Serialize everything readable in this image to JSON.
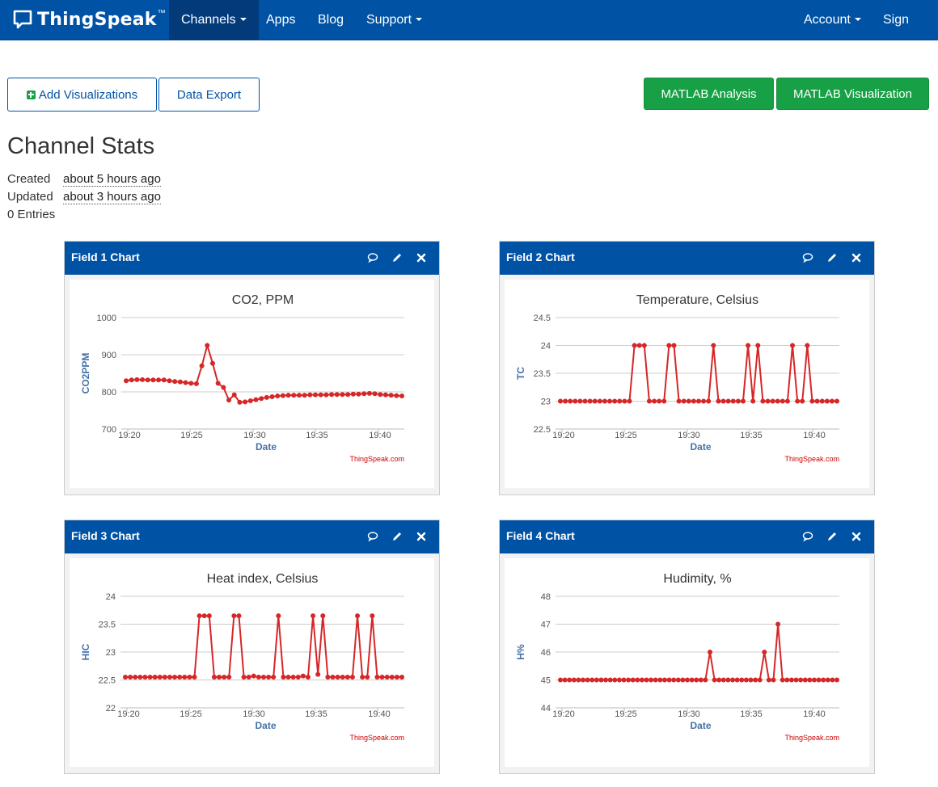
{
  "nav": {
    "brand": "ThingSpeak",
    "brand_tm": "™",
    "items": [
      "Channels",
      "Apps",
      "Blog",
      "Support"
    ],
    "account": "Account",
    "sign_out": "Sign Out"
  },
  "toolbar": {
    "add_visualizations": "Add Visualizations",
    "data_export": "Data Export",
    "matlab_analysis": "MATLAB Analysis",
    "matlab_visualization": "MATLAB Visualization"
  },
  "stats": {
    "title": "Channel Stats",
    "created_label": "Created",
    "created_value": "about 5 hours ago",
    "updated_label": "Updated",
    "updated_value": "about 3 hours ago",
    "entries": "0 Entries"
  },
  "colors": {
    "nav_bg": "#0052a5",
    "nav_active": "#023a7a",
    "green": "#17a045",
    "series": "#d62728",
    "axis_label": "#4572a7"
  },
  "chart_data": [
    {
      "panel_title": "Field 1 Chart",
      "type": "line",
      "title": "CO2, PPM",
      "xlabel": "Date",
      "ylabel": "CO2PPM",
      "credit": "ThingSpeak.com",
      "ylim": [
        700,
        1000
      ],
      "yticks": [
        700,
        800,
        900,
        1000
      ],
      "ytick_labels": [
        "700",
        "800",
        "900",
        "1000"
      ],
      "xlim": [
        19.3,
        19.7
      ],
      "xticks": [
        "19:20",
        "19:25",
        "19:30",
        "19:35",
        "19:40"
      ],
      "series": [
        {
          "values": [
            830,
            832,
            833,
            833,
            832,
            832,
            832,
            832,
            830,
            828,
            827,
            825,
            823,
            822,
            870,
            925,
            877,
            823,
            812,
            778,
            792,
            772,
            773,
            776,
            779,
            782,
            785,
            787,
            789,
            790,
            791,
            791,
            791,
            791,
            792,
            792,
            792,
            792,
            793,
            793,
            793,
            793,
            794,
            794,
            795,
            796,
            795,
            793,
            792,
            791,
            790,
            789
          ]
        }
      ]
    },
    {
      "panel_title": "Field 2 Chart",
      "type": "line",
      "title": "Temperature, Celsius",
      "xlabel": "Date",
      "ylabel": "TC",
      "credit": "ThingSpeak.com",
      "ylim": [
        22.5,
        24.5
      ],
      "yticks": [
        22.5,
        23,
        23.5,
        24,
        24.5
      ],
      "ytick_labels": [
        "22.5",
        "23",
        "23.5",
        "24",
        "24.5"
      ],
      "xticks": [
        "19:20",
        "19:25",
        "19:30",
        "19:35",
        "19:40"
      ],
      "series": [
        {
          "values": [
            23,
            23,
            23,
            23,
            23,
            23,
            23,
            23,
            23,
            23,
            23,
            23,
            23,
            23,
            23,
            24,
            24,
            24,
            23,
            23,
            23,
            23,
            24,
            24,
            23,
            23,
            23,
            23,
            23,
            23,
            23,
            24,
            23,
            23,
            23,
            23,
            23,
            23,
            24,
            23,
            24,
            23,
            23,
            23,
            23,
            23,
            23,
            24,
            23,
            23,
            24,
            23,
            23,
            23,
            23,
            23,
            23
          ]
        }
      ]
    },
    {
      "panel_title": "Field 3 Chart",
      "type": "line",
      "title": "Heat index, Celsius",
      "xlabel": "Date",
      "ylabel": "HIC",
      "credit": "ThingSpeak.com",
      "ylim": [
        22,
        24
      ],
      "yticks": [
        22,
        22.5,
        23,
        23.5,
        24
      ],
      "ytick_labels": [
        "22",
        "22.5",
        "23",
        "23.5",
        "24"
      ],
      "xticks": [
        "19:20",
        "19:25",
        "19:30",
        "19:35",
        "19:40"
      ],
      "series": [
        {
          "values": [
            22.55,
            22.55,
            22.55,
            22.55,
            22.55,
            22.55,
            22.55,
            22.55,
            22.55,
            22.55,
            22.55,
            22.55,
            22.55,
            22.55,
            22.55,
            23.65,
            23.65,
            23.65,
            22.55,
            22.55,
            22.55,
            22.55,
            23.65,
            23.65,
            22.55,
            22.55,
            22.57,
            22.55,
            22.55,
            22.55,
            22.55,
            23.65,
            22.55,
            22.55,
            22.55,
            22.55,
            22.57,
            22.55,
            23.65,
            22.6,
            23.65,
            22.55,
            22.55,
            22.55,
            22.55,
            22.55,
            22.55,
            23.65,
            22.55,
            22.55,
            23.65,
            22.55,
            22.55,
            22.55,
            22.55,
            22.55,
            22.55
          ]
        }
      ]
    },
    {
      "panel_title": "Field 4 Chart",
      "type": "line",
      "title": "Hudimity, %",
      "xlabel": "Date",
      "ylabel": "H%",
      "credit": "ThingSpeak.com",
      "ylim": [
        44,
        48
      ],
      "yticks": [
        44,
        45,
        46,
        47,
        48
      ],
      "ytick_labels": [
        "44",
        "45",
        "46",
        "47",
        "48"
      ],
      "xticks": [
        "19:20",
        "19:25",
        "19:30",
        "19:35",
        "19:40"
      ],
      "series": [
        {
          "values": [
            45,
            45,
            45,
            45,
            45,
            45,
            45,
            45,
            45,
            45,
            45,
            45,
            45,
            45,
            45,
            45,
            45,
            45,
            45,
            45,
            45,
            45,
            45,
            45,
            45,
            45,
            45,
            45,
            45,
            45,
            45,
            45,
            45,
            46,
            45,
            45,
            45,
            45,
            45,
            45,
            45,
            45,
            45,
            45,
            45,
            46,
            45,
            45,
            47,
            45,
            45,
            45,
            45,
            45,
            45,
            45,
            45,
            45,
            45,
            45,
            45,
            45
          ]
        }
      ]
    }
  ]
}
